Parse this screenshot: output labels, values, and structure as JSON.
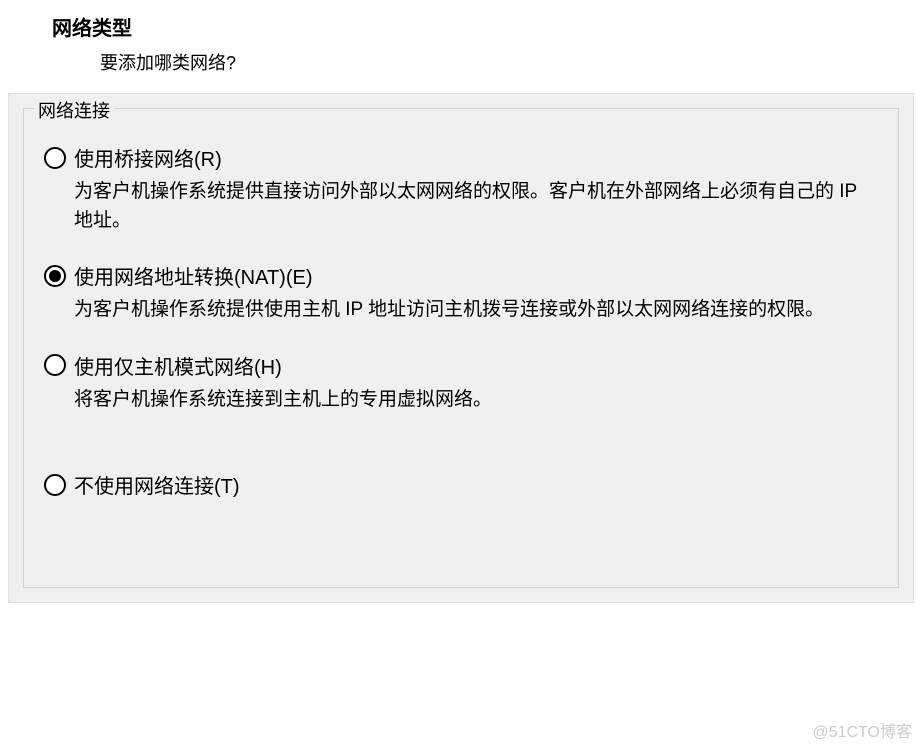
{
  "header": {
    "title": "网络类型",
    "subtitle": "要添加哪类网络?"
  },
  "fieldset": {
    "legend": "网络连接"
  },
  "options": {
    "bridged": {
      "label": "使用桥接网络(R)",
      "desc": "为客户机操作系统提供直接访问外部以太网网络的权限。客户机在外部网络上必须有自己的 IP 地址。",
      "selected": false
    },
    "nat": {
      "label": "使用网络地址转换(NAT)(E)",
      "desc": "为客户机操作系统提供使用主机 IP 地址访问主机拨号连接或外部以太网网络连接的权限。",
      "selected": true
    },
    "hostonly": {
      "label": "使用仅主机模式网络(H)",
      "desc": "将客户机操作系统连接到主机上的专用虚拟网络。",
      "selected": false
    },
    "none": {
      "label": "不使用网络连接(T)",
      "selected": false
    }
  },
  "watermark": "@51CTO博客"
}
